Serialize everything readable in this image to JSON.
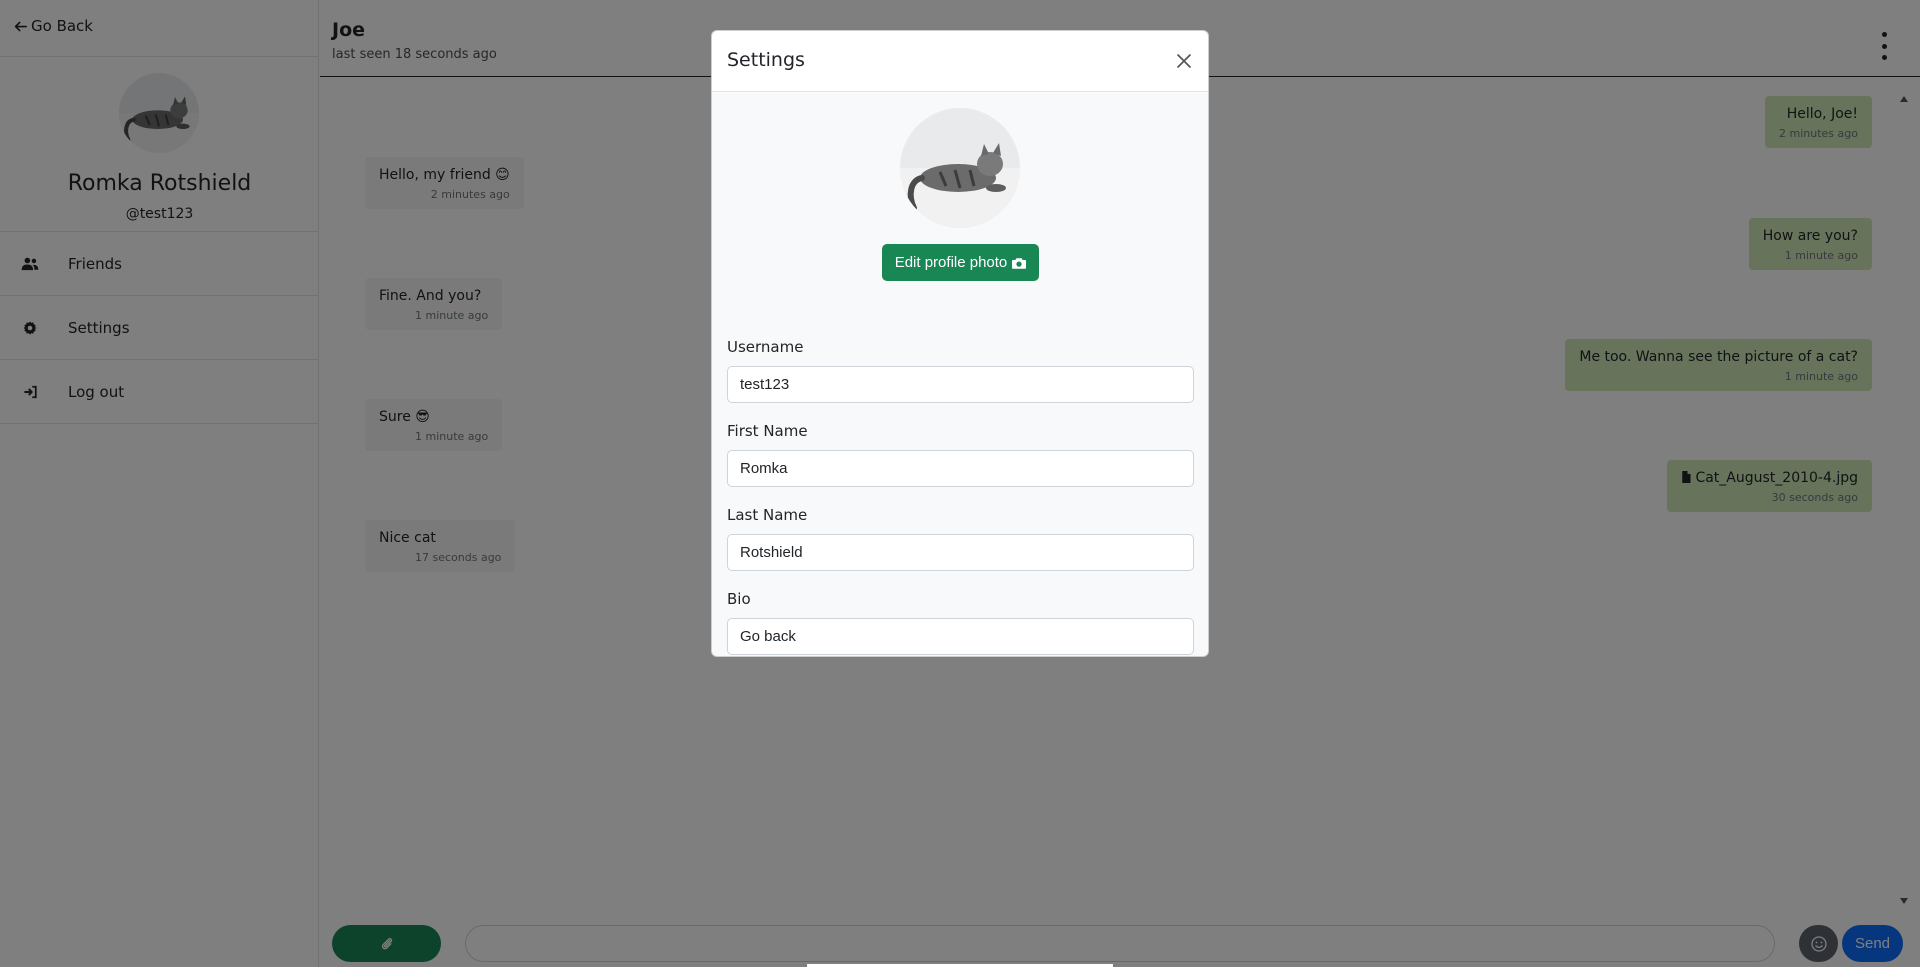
{
  "sidebar": {
    "go_back_label": "Go Back",
    "user_name": "Romka Rotshield",
    "user_handle": "@test123",
    "menu": [
      {
        "label": "Friends",
        "icon": "users-icon"
      },
      {
        "label": "Settings",
        "icon": "gear-icon"
      },
      {
        "label": "Log out",
        "icon": "logout-icon"
      }
    ]
  },
  "chat": {
    "contact_name": "Joe",
    "contact_status": "last seen 18 seconds ago",
    "messages": [
      {
        "direction": "out",
        "text": "Hello, Joe!",
        "time": "2 minutes ago"
      },
      {
        "direction": "in",
        "text": "Hello, my friend 😊",
        "time": "2 minutes ago"
      },
      {
        "direction": "out",
        "text": "How are you?",
        "time": "1 minute ago"
      },
      {
        "direction": "in",
        "text": "Fine. And you?",
        "time": "1 minute ago"
      },
      {
        "direction": "out",
        "text": "Me too. Wanna see the picture of a cat?",
        "time": "1 minute ago"
      },
      {
        "direction": "in",
        "text": "Sure 😎",
        "time": "1 minute ago"
      },
      {
        "direction": "out",
        "text": "Cat_August_2010-4.jpg",
        "time": "30 seconds ago",
        "attachment": true
      },
      {
        "direction": "in",
        "text": "Nice cat",
        "time": "17 seconds ago"
      }
    ],
    "composer": {
      "message_placeholder": "",
      "send_label": "Send"
    }
  },
  "settings_modal": {
    "title": "Settings",
    "edit_photo_label": "Edit profile photo",
    "fields": {
      "username": {
        "label": "Username",
        "value": "test123"
      },
      "first_name": {
        "label": "First Name",
        "value": "Romka"
      },
      "last_name": {
        "label": "Last Name",
        "value": "Rotshield"
      },
      "bio": {
        "label": "Bio",
        "value": "Go back"
      }
    }
  },
  "colors": {
    "primary_green": "#198754",
    "send_blue": "#0d6efd",
    "outgoing_bubble": "#d1e7b8",
    "incoming_bubble": "#f5f5f5",
    "backdrop": "rgba(0,0,0,0.5)"
  }
}
